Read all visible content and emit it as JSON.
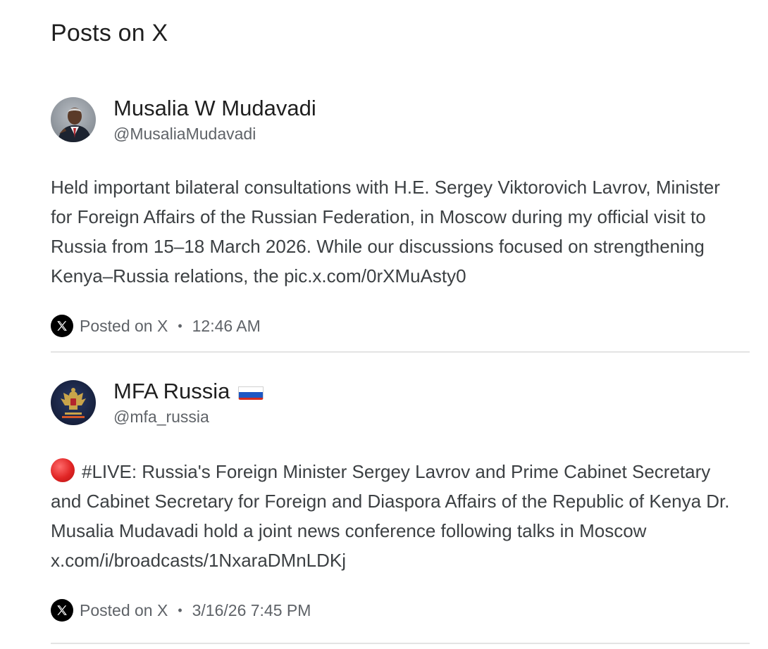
{
  "section": {
    "title": "Posts on X"
  },
  "posts": [
    {
      "author_name": "Musalia W Mudavadi",
      "author_handle": "@MusaliaMudavadi",
      "body": "Held important bilateral consultations with H.E. Sergey Viktorovich Lavrov, Minister for Foreign Affairs of the Russian Federation, in Moscow during my official visit to Russia from 15–18 March 2026. While our discussions focused on strengthening Kenya–Russia relations, the pic.x.com/0rXMuAsty0",
      "source": "Posted on X",
      "separator": "•",
      "time": "12:46 AM",
      "avatar_icon": "person-portrait-avatar"
    },
    {
      "author_name": "MFA Russia",
      "author_flag": "russia-flag-icon",
      "author_handle": "@mfa_russia",
      "live_icon": "red-circle-icon",
      "body": "#LIVE: Russia's Foreign Minister Sergey Lavrov and Prime Cabinet Secretary and Cabinet Secretary for Foreign and Diaspora Affairs of the Republic of Kenya Dr. Musalia Mudavadi hold a joint news conference following talks in Moscow x.com/i/broadcasts/1NxaraDMnLDKj",
      "source": "Posted on X",
      "separator": "•",
      "time": "3/16/26 7:45 PM",
      "avatar_icon": "coat-of-arms-avatar"
    }
  ],
  "colors": {
    "text_primary": "#1f1f1f",
    "text_body": "#3c4043",
    "text_secondary": "#5f6368",
    "divider": "#e3e3e3",
    "x_logo_bg": "#000000",
    "live_red": "#e02424"
  }
}
